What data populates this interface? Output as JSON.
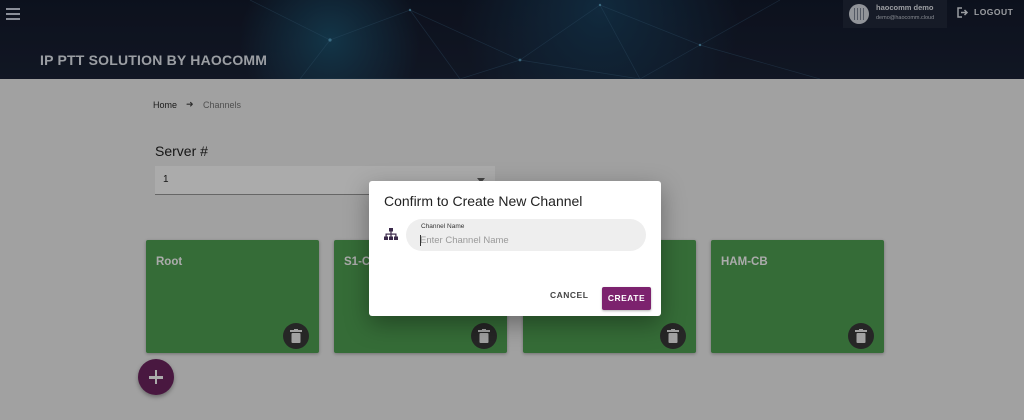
{
  "header": {
    "app_title": "IP PTT SOLUTION BY HAOCOMM",
    "user": {
      "name": "haocomm demo",
      "email": "demo@haocomm.cloud"
    },
    "logout_label": "LOGOUT"
  },
  "breadcrumb": {
    "home": "Home",
    "current": "Channels"
  },
  "server": {
    "label": "Server #",
    "selected": "1"
  },
  "channels": [
    {
      "name": "Root"
    },
    {
      "name": "S1-C"
    },
    {
      "name": ""
    },
    {
      "name": "HAM-CB"
    }
  ],
  "dialog": {
    "title": "Confirm to Create New Channel",
    "field_label": "Channel Name",
    "field_placeholder": "Enter Channel Name",
    "field_value": "",
    "cancel_label": "CANCEL",
    "create_label": "CREATE"
  },
  "colors": {
    "card": "#4fa152",
    "accent": "#7c226e",
    "header_bg": "#131a2c"
  },
  "icons": {
    "menu": "hamburger-icon",
    "logout": "logout-icon",
    "delete": "trash-icon",
    "add": "plus-icon",
    "field": "sitemap-icon"
  }
}
